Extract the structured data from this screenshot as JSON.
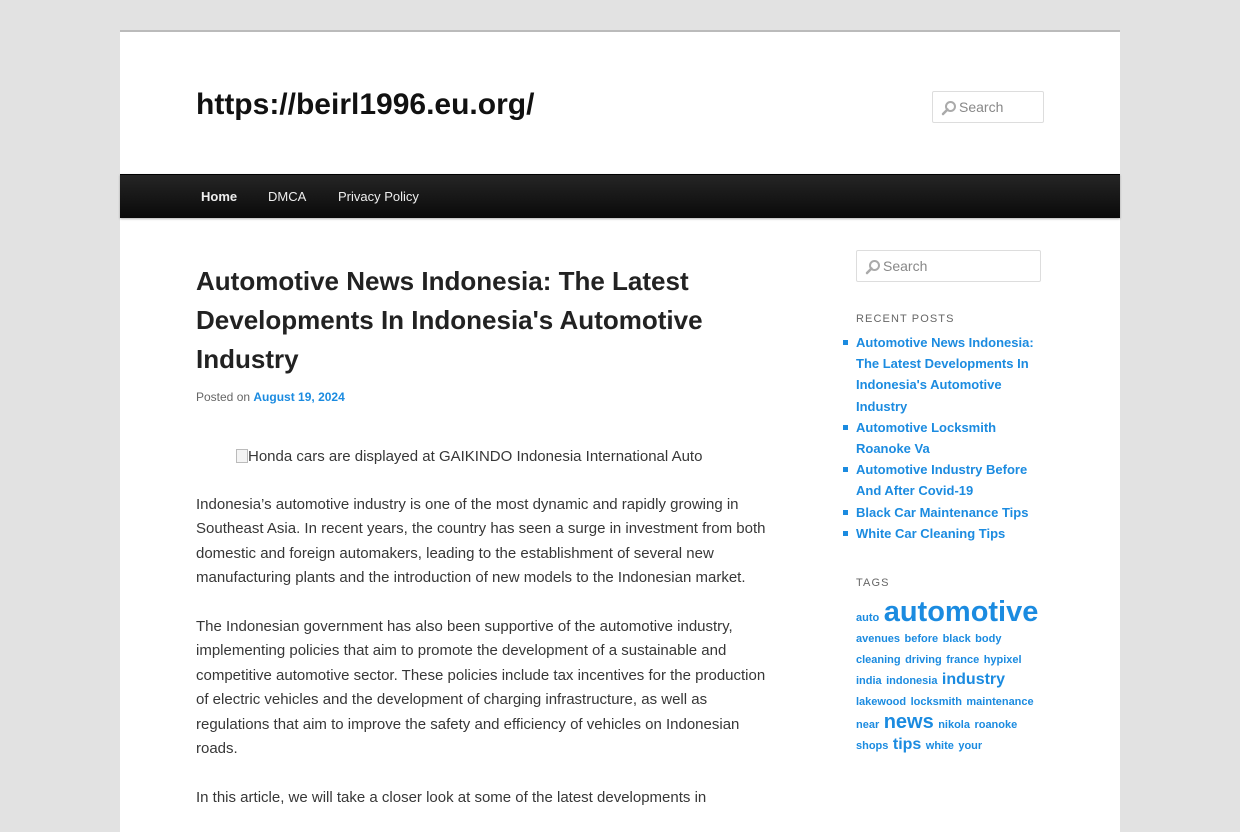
{
  "site": {
    "title": "https://beirl1996.eu.org/",
    "search_placeholder": "Search"
  },
  "nav": {
    "items": [
      {
        "label": "Home",
        "current": true
      },
      {
        "label": "DMCA",
        "current": false
      },
      {
        "label": "Privacy Policy",
        "current": false
      }
    ]
  },
  "post": {
    "title": "Automotive News Indonesia: The Latest Developments In Indonesia's Automotive Industry",
    "posted_on_label": "Posted on",
    "date": "August 19, 2024",
    "image_alt": "Honda cars are displayed at GAIKINDO Indonesia International Auto",
    "paragraphs": [
      "Indonesia’s automotive industry is one of the most dynamic and rapidly growing in Southeast Asia. In recent years, the country has seen a surge in investment from both domestic and foreign automakers, leading to the establishment of several new manufacturing plants and the introduction of new models to the Indonesian market.",
      "The Indonesian government has also been supportive of the automotive industry, implementing policies that aim to promote the development of a sustainable and competitive automotive sector. These policies include tax incentives for the production of electric vehicles and the development of charging infrastructure, as well as regulations that aim to improve the safety and efficiency of vehicles on Indonesian roads.",
      "In this article, we will take a closer look at some of the latest developments in"
    ]
  },
  "sidebar": {
    "search_placeholder": "Search",
    "recent_posts_title": "RECENT POSTS",
    "recent_posts": [
      "Automotive News Indonesia: The Latest Developments In Indonesia's Automotive Industry",
      "Automotive Locksmith Roanoke Va",
      "Automotive Industry Before And After Covid-19",
      "Black Car Maintenance Tips",
      "White Car Cleaning Tips"
    ],
    "tags_title": "TAGS",
    "tags": [
      {
        "label": "auto",
        "size": 11
      },
      {
        "label": "automotive",
        "size": 29
      },
      {
        "label": "avenues",
        "size": 11
      },
      {
        "label": "before",
        "size": 11
      },
      {
        "label": "black",
        "size": 11
      },
      {
        "label": "body",
        "size": 11
      },
      {
        "label": "cleaning",
        "size": 11
      },
      {
        "label": "driving",
        "size": 11
      },
      {
        "label": "france",
        "size": 11
      },
      {
        "label": "hypixel",
        "size": 11
      },
      {
        "label": "india",
        "size": 11
      },
      {
        "label": "indonesia",
        "size": 11
      },
      {
        "label": "industry",
        "size": 16
      },
      {
        "label": "lakewood",
        "size": 11
      },
      {
        "label": "locksmith",
        "size": 11
      },
      {
        "label": "maintenance",
        "size": 11
      },
      {
        "label": "near",
        "size": 11
      },
      {
        "label": "news",
        "size": 20
      },
      {
        "label": "nikola",
        "size": 11
      },
      {
        "label": "roanoke",
        "size": 11
      },
      {
        "label": "shops",
        "size": 11
      },
      {
        "label": "tips",
        "size": 16
      },
      {
        "label": "white",
        "size": 11
      },
      {
        "label": "your",
        "size": 11
      }
    ]
  }
}
